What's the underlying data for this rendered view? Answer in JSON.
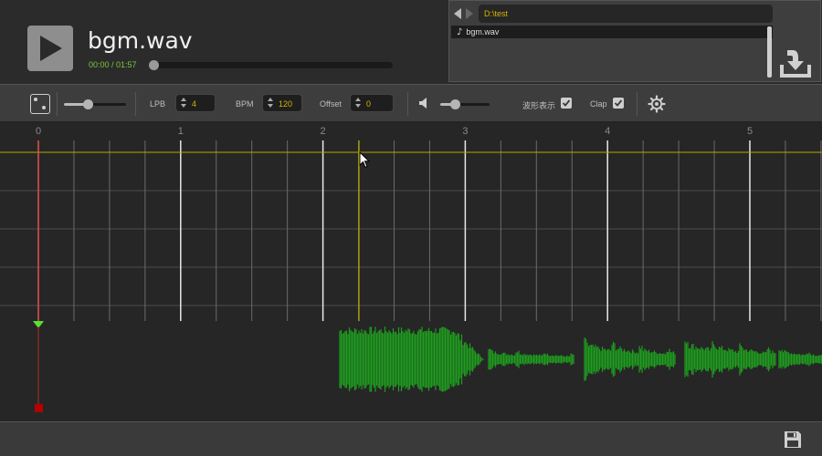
{
  "header": {
    "filename": "bgm.wav",
    "time": "00:00 / 01:57",
    "progress": 0.0
  },
  "browser": {
    "path": "D:\\test",
    "files": [
      "bgm.wav"
    ]
  },
  "toolbar": {
    "lpb_label": "LPB",
    "lpb_value": "4",
    "bpm_label": "BPM",
    "bpm_value": "120",
    "offset_label": "Offset",
    "offset_value": "0",
    "waveform_label": "波形表示",
    "waveform_checked": true,
    "clap_label": "Clap",
    "clap_checked": true,
    "zoom_level": 0.38,
    "volume_level": 0.3
  },
  "timeline": {
    "beat_labels": [
      "0",
      "1",
      "2",
      "3",
      "4",
      "5"
    ]
  },
  "colors": {
    "accent_green": "#7dc53a",
    "path_yellow": "#d6b500",
    "waveform": "#1e9e1e",
    "playhead": "#e05050",
    "cursor_line": "#b8a800"
  }
}
